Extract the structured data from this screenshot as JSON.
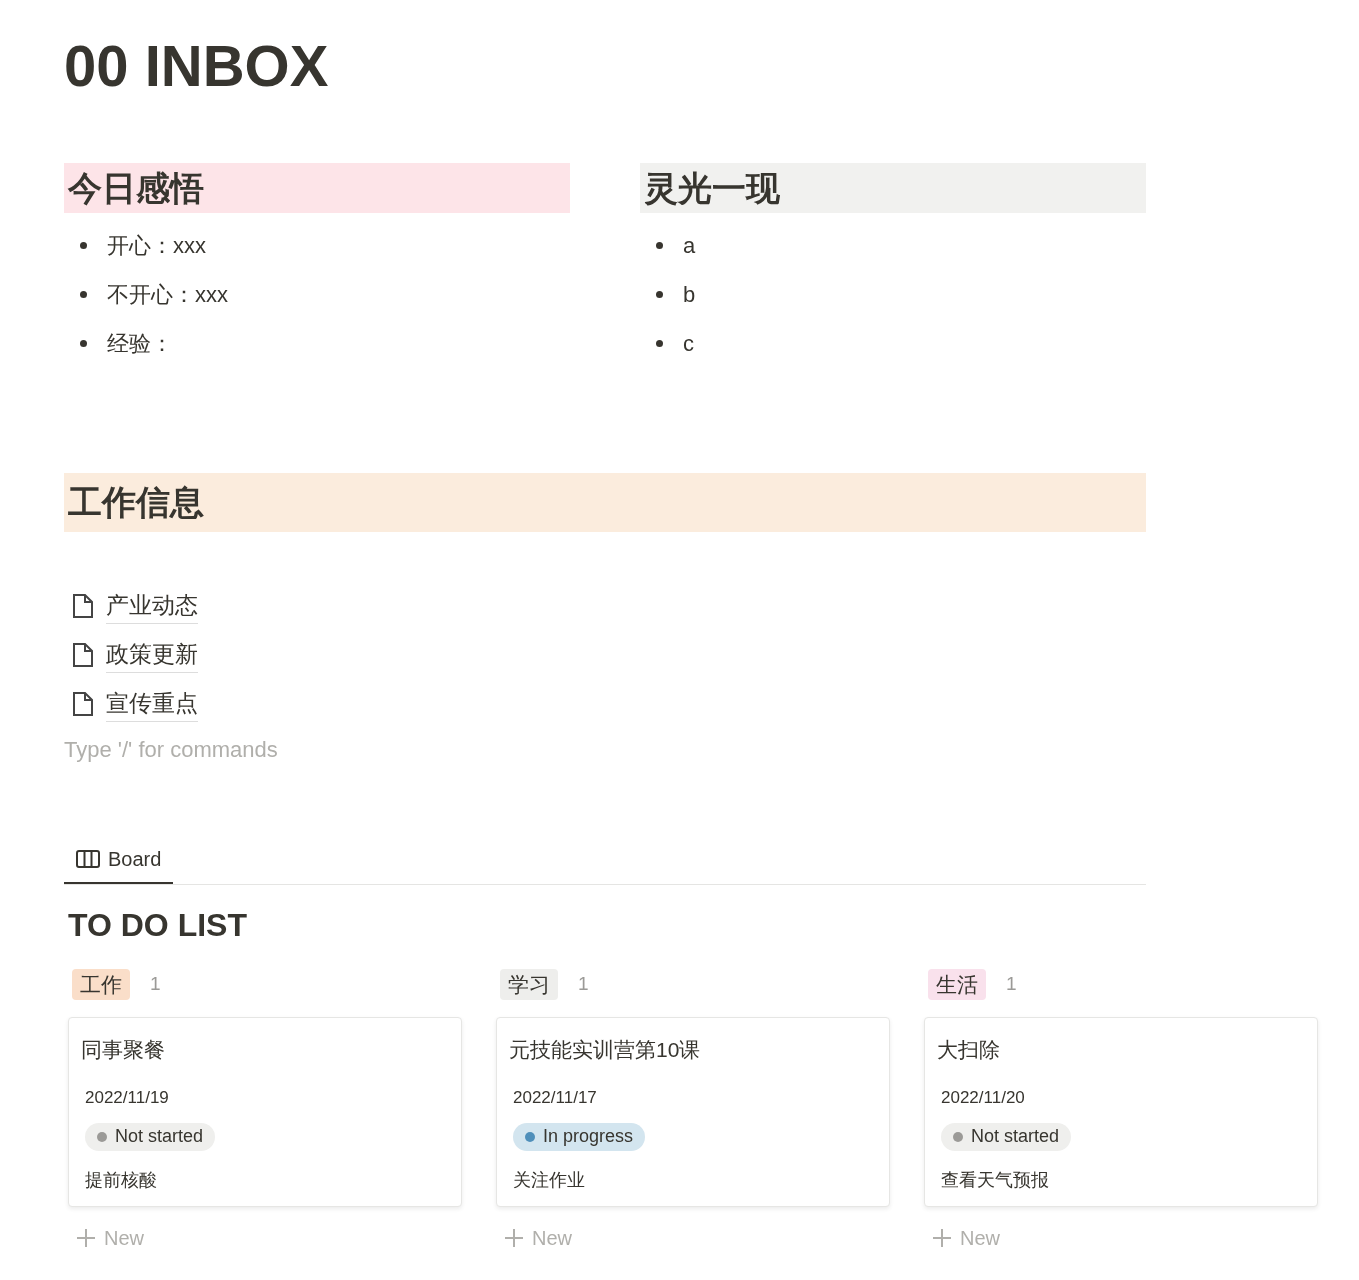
{
  "title": "00 INBOX",
  "sections": [
    {
      "heading": "今日感悟",
      "color": "#fde4e8",
      "items": [
        "开心：xxx",
        "不开心：xxx",
        "经验："
      ]
    },
    {
      "heading": "灵光一现",
      "color": "#f1f1ef",
      "items": [
        "a",
        "b",
        "c"
      ]
    }
  ],
  "work": {
    "heading": "工作信息",
    "color": "#fbecdd",
    "pages": [
      "产业动态",
      "政策更新",
      "宣传重点"
    ],
    "placeholder": "Type '/' for commands"
  },
  "views": [
    {
      "label": "Board",
      "selected": true
    }
  ],
  "board": {
    "title": "TO DO LIST",
    "columns": [
      {
        "name": "工作",
        "color": "#fadec9",
        "count": "1",
        "cards": [
          {
            "title": "同事聚餐",
            "date": "2022/11/19",
            "status": {
              "label": "Not started",
              "kind": "not_started"
            },
            "note": "提前核酸"
          }
        ],
        "new": "New"
      },
      {
        "name": "学习",
        "color": "#eeeeec",
        "count": "1",
        "cards": [
          {
            "title": "元技能实训营第10课",
            "date": "2022/11/17",
            "status": {
              "label": "In progress",
              "kind": "in_progress"
            },
            "note": "关注作业"
          }
        ],
        "new": "New"
      },
      {
        "name": "生活",
        "color": "#f9e1ec",
        "count": "1",
        "cards": [
          {
            "title": "大扫除",
            "date": "2022/11/20",
            "status": {
              "label": "Not started",
              "kind": "not_started"
            },
            "note": "查看天气预报"
          }
        ],
        "new": "New"
      }
    ]
  }
}
